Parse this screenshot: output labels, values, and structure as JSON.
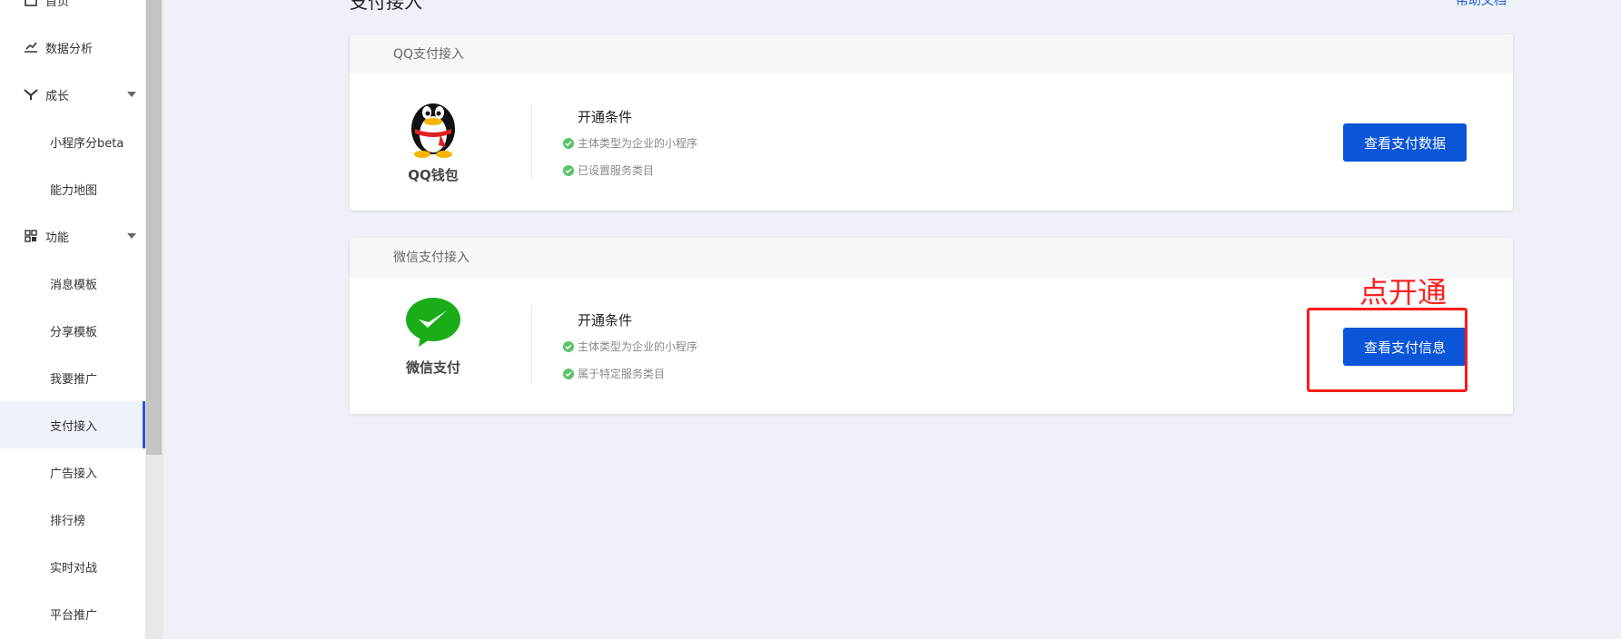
{
  "sidebar": {
    "items": [
      {
        "label": "首页",
        "icon": "home-icon"
      },
      {
        "label": "数据分析",
        "icon": "chart-icon"
      },
      {
        "label": "成长",
        "icon": "growth-icon"
      },
      {
        "label": "小程序分beta"
      },
      {
        "label": "能力地图"
      },
      {
        "label": "功能",
        "icon": "grid-icon"
      },
      {
        "label": "消息模板"
      },
      {
        "label": "分享模板"
      },
      {
        "label": "我要推广"
      },
      {
        "label": "支付接入",
        "active": true
      },
      {
        "label": "广告接入"
      },
      {
        "label": "排行榜"
      },
      {
        "label": "实时对战"
      },
      {
        "label": "平台推广"
      }
    ]
  },
  "header": {
    "title": "支付接入",
    "help_link": "帮助文档"
  },
  "cards": [
    {
      "header": "QQ支付接入",
      "logo": "qq-penguin-icon",
      "logo_label": "QQ钱包",
      "cond_title": "开通条件",
      "conditions": [
        "主体类型为企业的小程序",
        "已设置服务类目"
      ],
      "button": "查看支付数据"
    },
    {
      "header": "微信支付接入",
      "logo": "wechat-pay-icon",
      "logo_label": "微信支付",
      "cond_title": "开通条件",
      "conditions": [
        "主体类型为企业的小程序",
        "属于特定服务类目"
      ],
      "button": "查看支付信息"
    }
  ],
  "annotation": {
    "text": "点开通",
    "color": "#ff1a1a"
  },
  "colors": {
    "accent": "#0a55d8",
    "check": "#5cc36b",
    "background": "#eef1f7"
  }
}
